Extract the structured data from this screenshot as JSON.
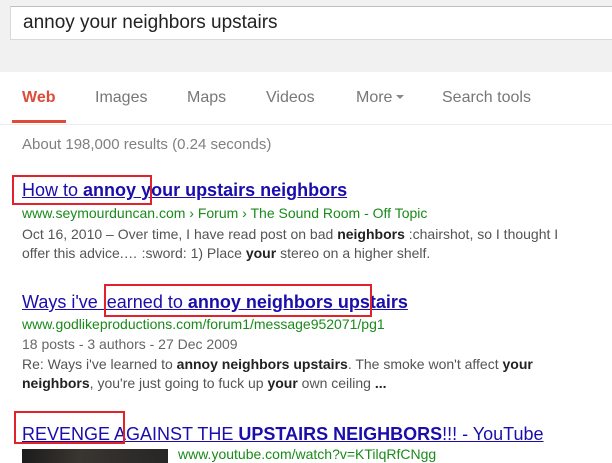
{
  "search": {
    "query": "annoy your neighbors upstairs"
  },
  "tabs": [
    {
      "label": "Web",
      "active": true
    },
    {
      "label": "Images"
    },
    {
      "label": "Maps"
    },
    {
      "label": "Videos"
    },
    {
      "label": "More"
    },
    {
      "label": "Search tools"
    }
  ],
  "stats": "About 198,000 results (0.24 seconds)",
  "results": [
    {
      "title": [
        {
          "t": "How to ",
          "b": false
        },
        {
          "t": "annoy",
          "b": true
        },
        {
          "t": " ",
          "b": false
        },
        {
          "t": "your upstairs neighbors",
          "b": true
        }
      ],
      "url": "www.seymourduncan.com › Forum › The Sound Room - Off Topic",
      "snippet_lines": [
        [
          {
            "t": "Oct 16, 2010 – Over time, I have read post on bad ",
            "b": false
          },
          {
            "t": "neighbors",
            "b": true
          },
          {
            "t": " :chairshot, so I thought I",
            "b": false
          }
        ],
        [
          {
            "t": "offer this advice.… :sword: 1) Place ",
            "b": false
          },
          {
            "t": "your",
            "b": true
          },
          {
            "t": " stereo on a higher shelf.",
            "b": false
          }
        ]
      ]
    },
    {
      "title": [
        {
          "t": "Ways i've learned to ",
          "b": false
        },
        {
          "t": "annoy neighbors",
          "b": true
        },
        {
          "t": " ",
          "b": false
        },
        {
          "t": "upstairs",
          "b": true
        }
      ],
      "url": "www.godlikeproductions.com/forum1/message952071/pg1",
      "meta": "18 posts - 3 authors - 27 Dec 2009",
      "snippet_lines": [
        [
          {
            "t": "Re: Ways i've learned to ",
            "b": false
          },
          {
            "t": "annoy neighbors upstairs",
            "b": true
          },
          {
            "t": ". The smoke won't affect ",
            "b": false
          },
          {
            "t": "your",
            "b": true
          }
        ],
        [
          {
            "t": "neighbors",
            "b": true
          },
          {
            "t": ", you're just going to fuck up ",
            "b": false
          },
          {
            "t": "your",
            "b": true
          },
          {
            "t": " own ceiling ",
            "b": false
          },
          {
            "t": "...",
            "b": true
          }
        ]
      ]
    },
    {
      "title": [
        {
          "t": "REVENGE AGAINST THE ",
          "b": false
        },
        {
          "t": "UPSTAIRS NEIGHBORS",
          "b": true
        },
        {
          "t": "!!! - YouTube",
          "b": false
        }
      ],
      "url": "www.youtube.com/watch?v=KTilqRfCNgg"
    }
  ]
}
